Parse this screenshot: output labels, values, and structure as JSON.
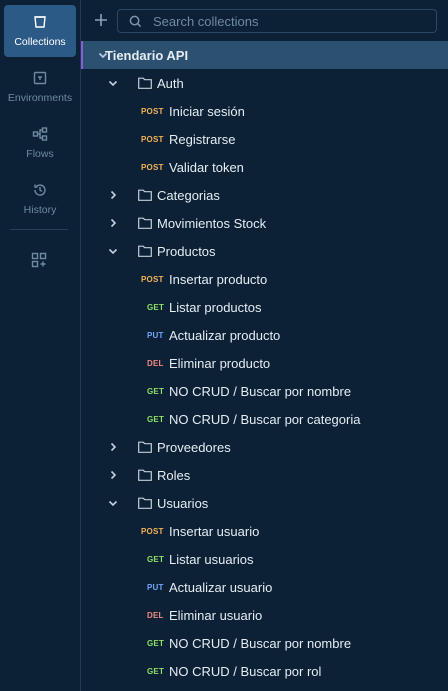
{
  "rail": {
    "items": [
      {
        "label": "Collections",
        "icon": "collections-icon",
        "active": true
      },
      {
        "label": "Environments",
        "icon": "environments-icon",
        "active": false
      },
      {
        "label": "Flows",
        "icon": "flows-icon",
        "active": false
      },
      {
        "label": "History",
        "icon": "history-icon",
        "active": false
      }
    ],
    "add_icon": "add-workspace-icon"
  },
  "search": {
    "placeholder": "Search collections"
  },
  "colors": {
    "post": "#f5b453",
    "get": "#8ee06a",
    "put": "#6fa6ff",
    "del": "#f08a83",
    "root_accent": "#8a5cd6"
  },
  "tree": {
    "root": "Tiendario API",
    "folders": {
      "auth": {
        "name": "Auth",
        "requests": [
          {
            "method": "POST",
            "name": "Iniciar sesión"
          },
          {
            "method": "POST",
            "name": "Registrarse"
          },
          {
            "method": "POST",
            "name": "Validar token"
          }
        ]
      },
      "categorias": {
        "name": "Categorias"
      },
      "movimientos": {
        "name": "Movimientos Stock"
      },
      "productos": {
        "name": "Productos",
        "requests": [
          {
            "method": "POST",
            "name": "Insertar producto"
          },
          {
            "method": "GET",
            "name": "Listar productos"
          },
          {
            "method": "PUT",
            "name": "Actualizar producto"
          },
          {
            "method": "DEL",
            "name": "Eliminar producto"
          },
          {
            "method": "GET",
            "name": "NO CRUD / Buscar por nombre"
          },
          {
            "method": "GET",
            "name": "NO CRUD / Buscar por categoria"
          }
        ]
      },
      "proveedores": {
        "name": "Proveedores"
      },
      "roles": {
        "name": "Roles"
      },
      "usuarios": {
        "name": "Usuarios",
        "requests": [
          {
            "method": "POST",
            "name": "Insertar usuario"
          },
          {
            "method": "GET",
            "name": "Listar usuarios"
          },
          {
            "method": "PUT",
            "name": "Actualizar usuario"
          },
          {
            "method": "DEL",
            "name": "Eliminar usuario"
          },
          {
            "method": "GET",
            "name": "NO CRUD / Buscar por nombre"
          },
          {
            "method": "GET",
            "name": "NO CRUD / Buscar por rol"
          }
        ]
      }
    }
  }
}
